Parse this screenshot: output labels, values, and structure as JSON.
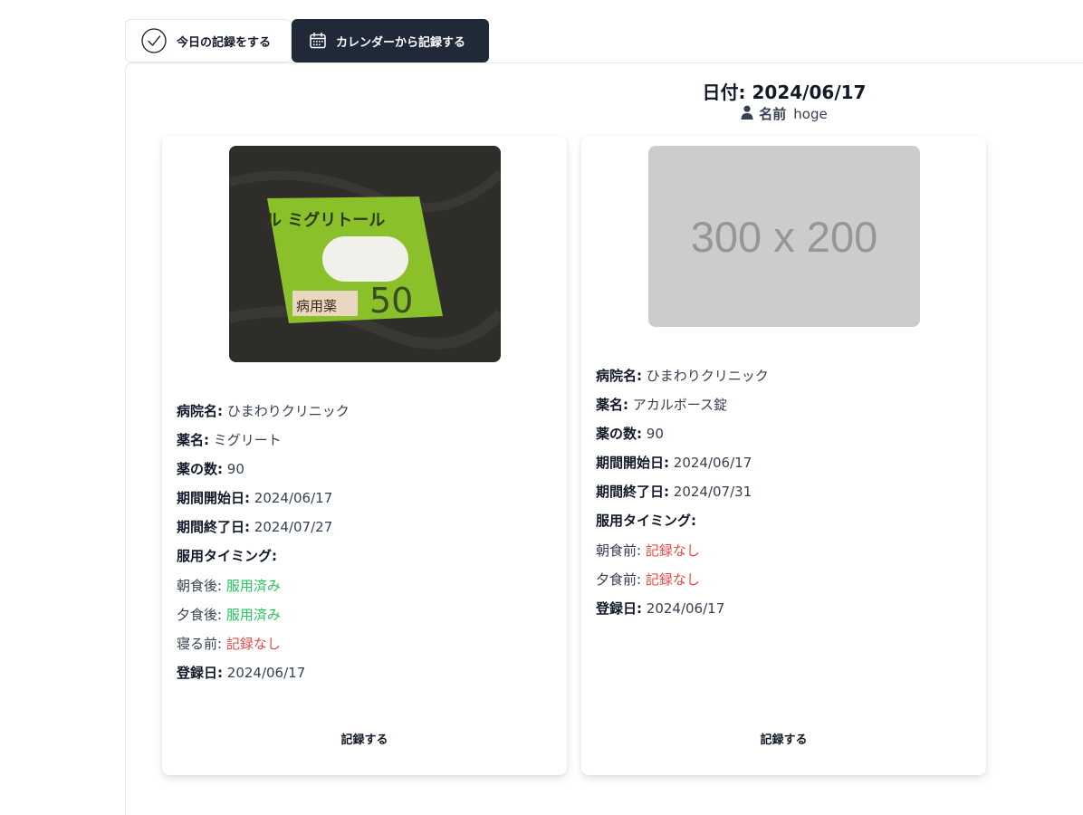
{
  "tabs": {
    "today_label": "今日の記録をする",
    "calendar_label": "カレンダーから記録する"
  },
  "header": {
    "date_label": "日付:",
    "date_value": "2024/06/17",
    "name_label": "名前",
    "name_value": "hoge"
  },
  "cards": [
    {
      "hospital_label": "病院名:",
      "hospital": "ひまわりクリニック",
      "drug_label": "薬名:",
      "drug": "ミグリート",
      "count_label": "薬の数:",
      "count": "90",
      "start_label": "期間開始日:",
      "start": "2024/06/17",
      "end_label": "期間終了日:",
      "end": "2024/07/27",
      "timing_label": "服用タイミング:",
      "timings": [
        {
          "label": "朝食後:",
          "status": "服用済み"
        },
        {
          "label": "夕食後:",
          "status": "服用済み"
        },
        {
          "label": "寝る前:",
          "status": "記録なし"
        }
      ],
      "registered_label": "登録日:",
      "registered": "2024/06/17",
      "record_button": "記録する",
      "photo_text": {
        "top": "ル ミグリトール",
        "bottom_left": "病用薬",
        "bottom_right": "50"
      }
    },
    {
      "image_placeholder": "300 x 200",
      "hospital_label": "病院名:",
      "hospital": "ひまわりクリニック",
      "drug_label": "薬名:",
      "drug": "アカルボース錠",
      "count_label": "薬の数:",
      "count": "90",
      "start_label": "期間開始日:",
      "start": "2024/06/17",
      "end_label": "期間終了日:",
      "end": "2024/07/31",
      "timing_label": "服用タイミング:",
      "timings": [
        {
          "label": "朝食前:",
          "status": "記録なし"
        },
        {
          "label": "夕食前:",
          "status": "記録なし"
        }
      ],
      "registered_label": "登録日:",
      "registered": "2024/06/17",
      "record_button": "記録する"
    }
  ],
  "colors": {
    "taken": "#22c55e",
    "none": "#ef4444",
    "active_tab": "#1f2937"
  },
  "icons": {
    "today_tab": "check-circle-icon",
    "calendar_tab": "calendar-icon",
    "user": "user-icon"
  }
}
